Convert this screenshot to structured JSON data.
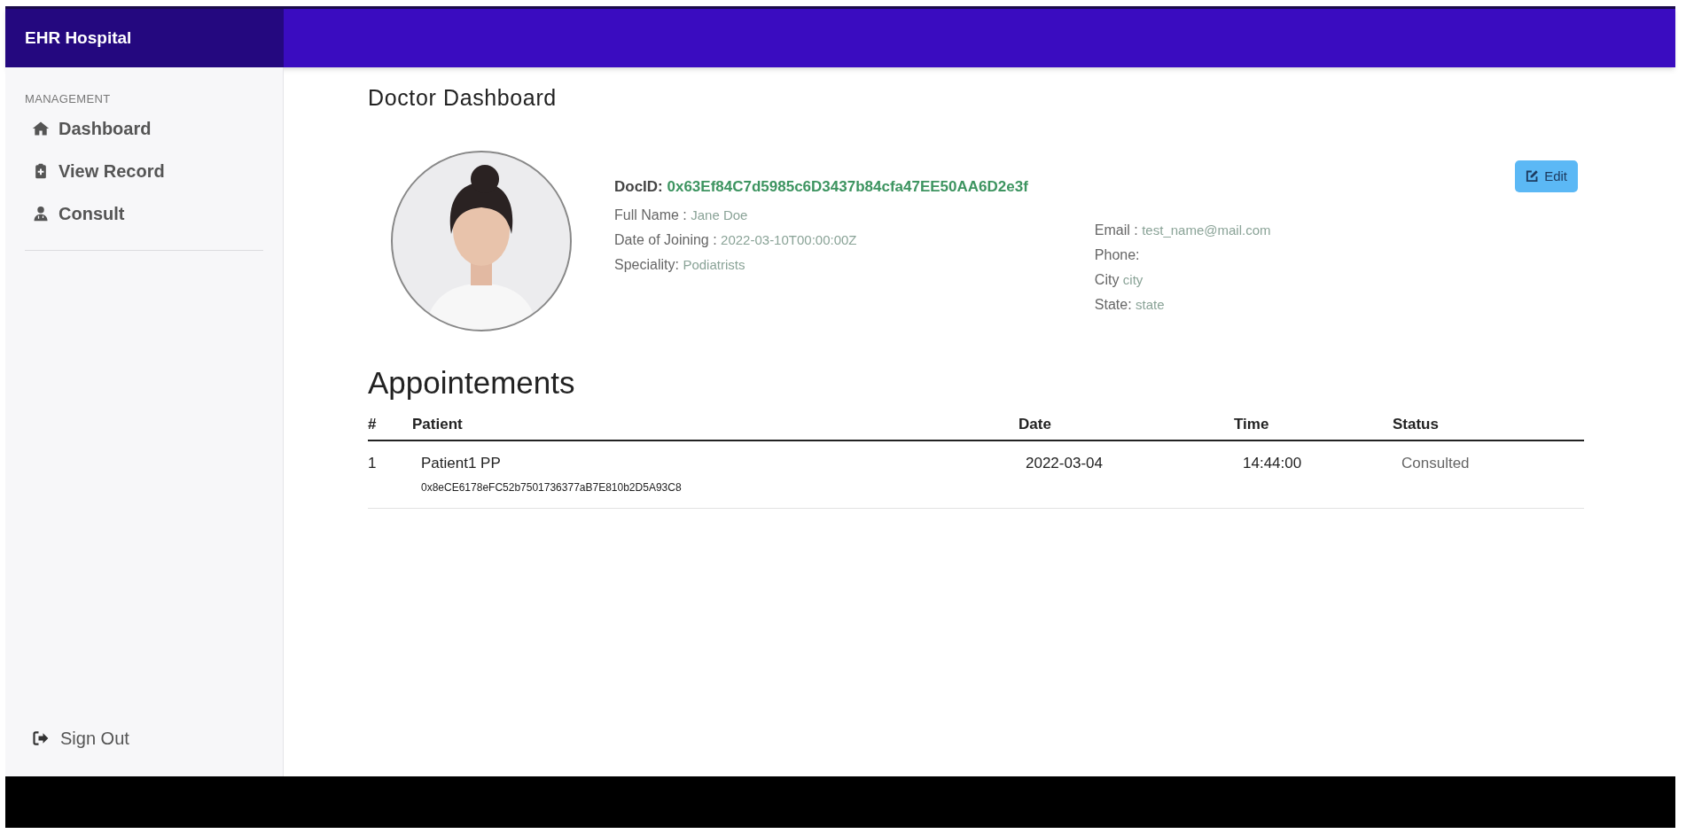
{
  "brand": "EHR Hospital",
  "sidebar": {
    "section": "MANAGEMENT",
    "items": [
      {
        "label": "Dashboard",
        "kind": "home"
      },
      {
        "label": "View Record",
        "kind": "record"
      },
      {
        "label": "Consult",
        "kind": "doctor"
      }
    ],
    "footer": {
      "label": "Sign Out",
      "kind": "signout"
    }
  },
  "page_title": "Doctor Dashboard",
  "profile": {
    "doc_id_label": "DocID:",
    "doc_id": "0x63Ef84C7d5985c6D3437b84cfa47EE50AA6D2e3f",
    "fields_left": [
      {
        "label": "Full Name :",
        "value": "Jane Doe"
      },
      {
        "label": "Date of Joining :",
        "value": "2022-03-10T00:00:00Z"
      },
      {
        "label": "Speciality:",
        "value": "Podiatrists"
      }
    ],
    "fields_right": [
      {
        "label": "Email :",
        "value": "test_name@mail.com"
      },
      {
        "label": "Phone:"
      },
      {
        "label": "City",
        "value": "city"
      },
      {
        "label": "State:",
        "value": "state"
      }
    ],
    "edit_button": "Edit"
  },
  "appointments": {
    "title": "Appointements",
    "columns": [
      "#",
      "Patient",
      "Date",
      "Time",
      "Status"
    ],
    "rows": [
      {
        "number": "1",
        "patient": "Patient1 PP",
        "address": "0x8eCE6178eFC52b7501736377aB7E810b2D5A93C8",
        "date": "2022-03-04",
        "time": "14:44:00",
        "status": "Consulted"
      }
    ]
  }
}
